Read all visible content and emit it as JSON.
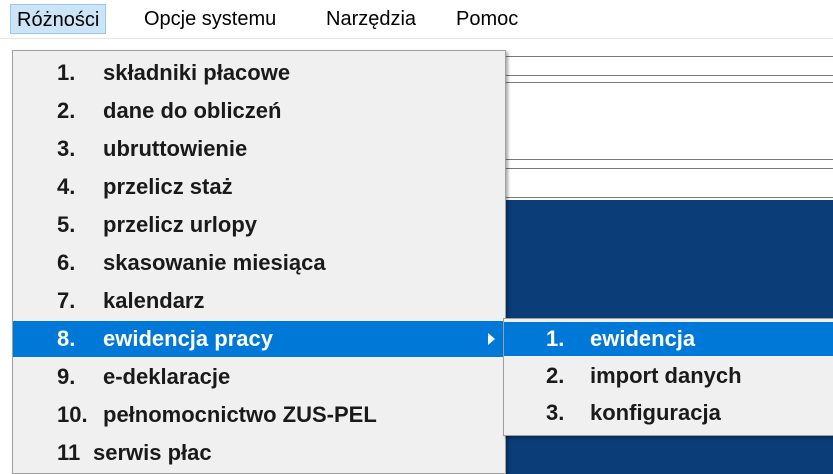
{
  "menubar": {
    "items": [
      {
        "label": "Różności"
      },
      {
        "label": "Opcje systemu"
      },
      {
        "label": "Narzędzia"
      },
      {
        "label": "Pomoc"
      }
    ]
  },
  "dropdown": {
    "items": [
      {
        "num": "1.",
        "label": "składniki płacowe"
      },
      {
        "num": "2.",
        "label": "dane do obliczeń"
      },
      {
        "num": "3.",
        "label": "ubruttowienie"
      },
      {
        "num": "4.",
        "label": "przelicz staż"
      },
      {
        "num": "5.",
        "label": "przelicz urlopy"
      },
      {
        "num": "6.",
        "label": "skasowanie miesiąca"
      },
      {
        "num": "7.",
        "label": "kalendarz"
      },
      {
        "num": "8.",
        "label": "ewidencja pracy"
      },
      {
        "num": "9.",
        "label": "e-deklaracje"
      },
      {
        "num": "10.",
        "label": "pełnomocnictwo ZUS-PEL"
      },
      {
        "num": "11",
        "label": "serwis płac"
      }
    ]
  },
  "submenu": {
    "items": [
      {
        "num": "1.",
        "label": "ewidencja"
      },
      {
        "num": "2.",
        "label": "import danych"
      },
      {
        "num": "3.",
        "label": "konfiguracja"
      }
    ]
  },
  "colors": {
    "highlight": "#0078d7",
    "menu_bg": "#f0f0f0",
    "active_menubar": "#cce4f7",
    "window_bg": "#0b3d78"
  },
  "icons": [
    "submenu-arrow-icon"
  ]
}
